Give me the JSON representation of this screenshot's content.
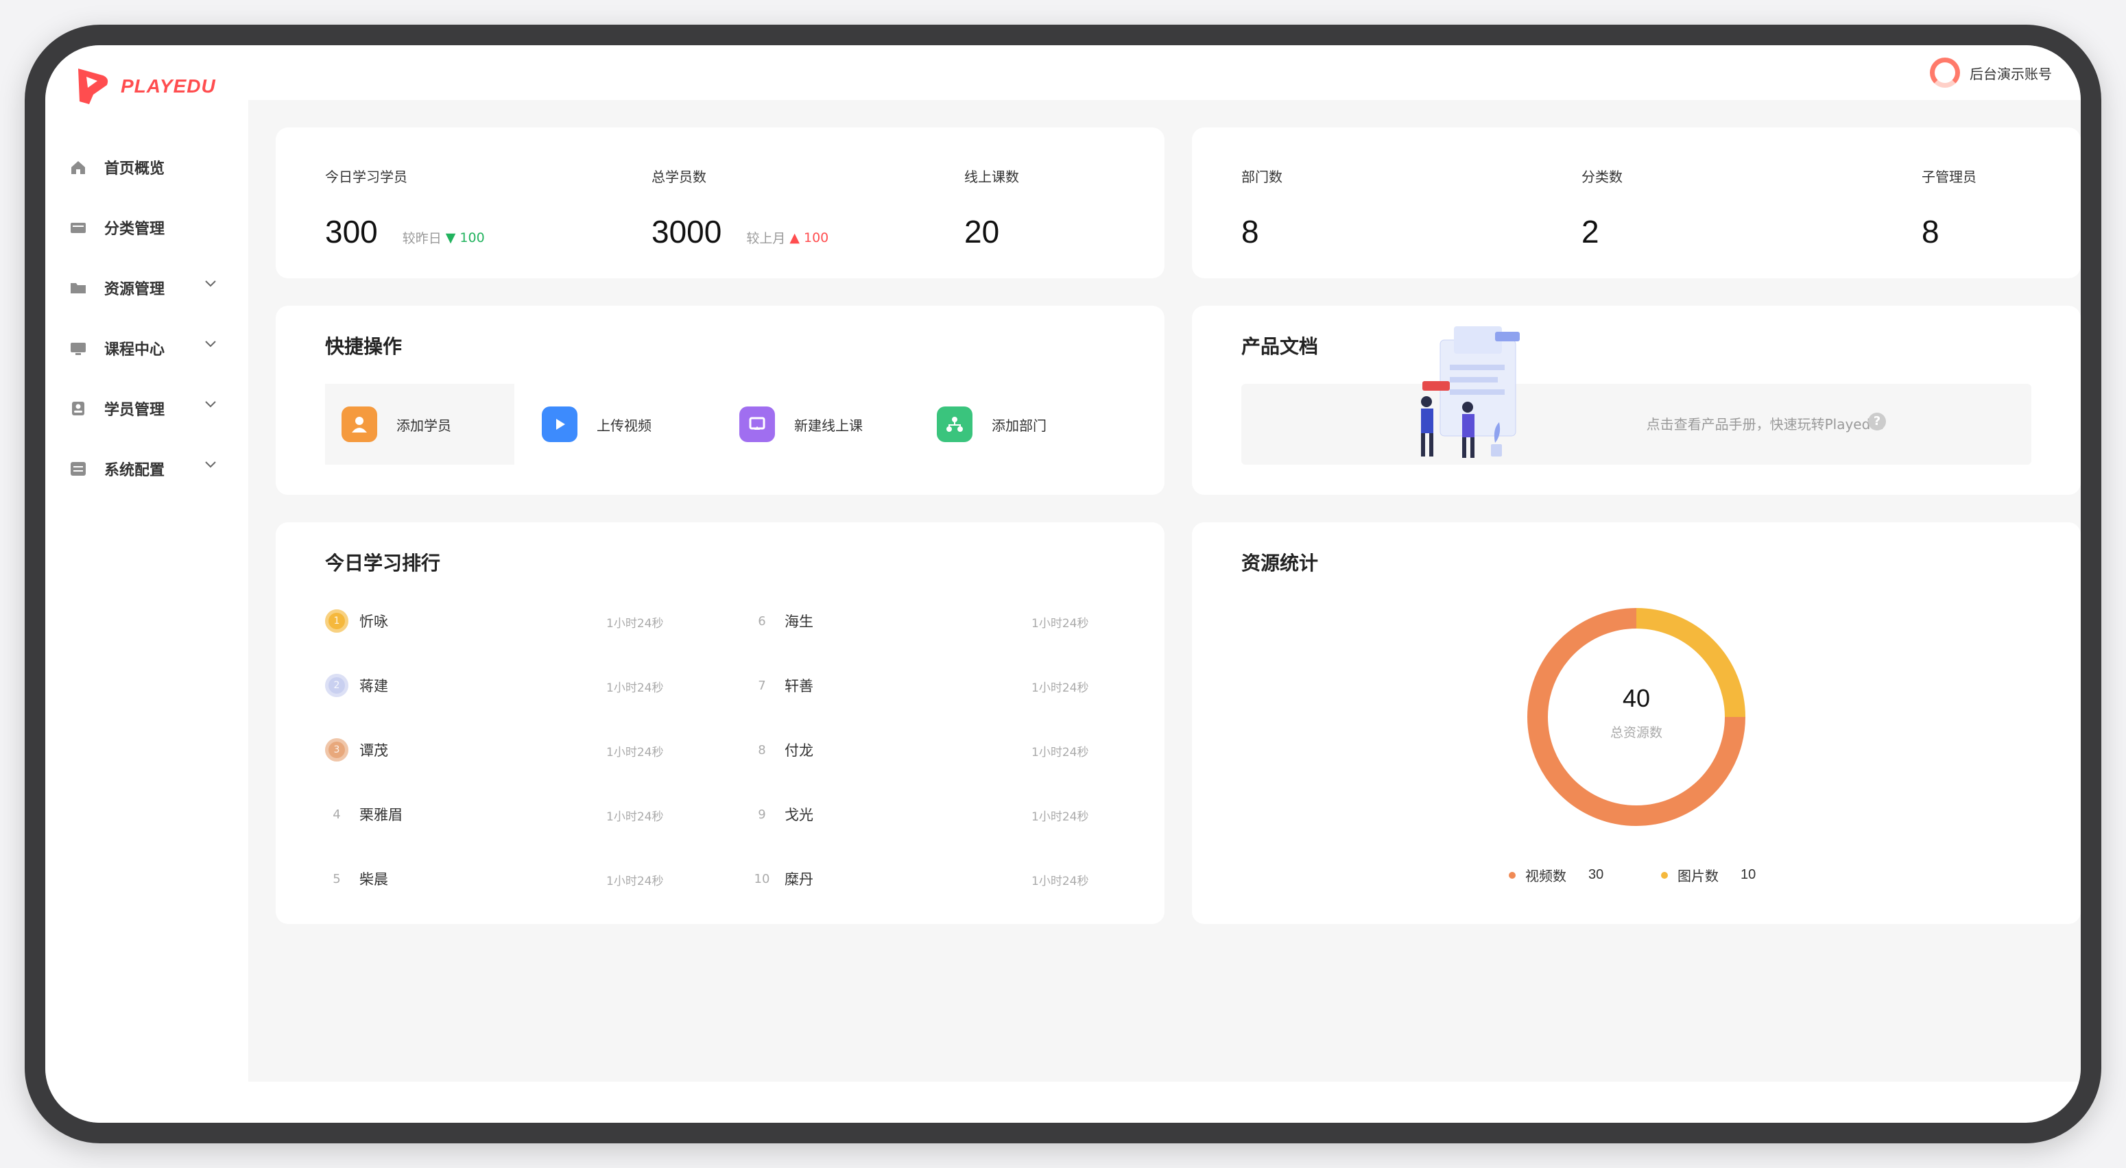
{
  "app": {
    "logo_text": "PLAYEDU",
    "brand_color": "#ff4d4f"
  },
  "topbar": {
    "user_name": "后台演示账号"
  },
  "sidebar": {
    "items": [
      {
        "label": "首页概览",
        "icon": "home-icon"
      },
      {
        "label": "分类管理",
        "icon": "category-icon"
      },
      {
        "label": "资源管理",
        "icon": "folder-icon"
      },
      {
        "label": "课程中心",
        "icon": "course-icon"
      },
      {
        "label": "学员管理",
        "icon": "user-icon"
      },
      {
        "label": "系统配置",
        "icon": "settings-icon"
      }
    ]
  },
  "stats_left": {
    "today_learners": {
      "label": "今日学习学员",
      "value": "300",
      "compare_label": "较昨日",
      "trend": "▼",
      "delta": "100"
    },
    "total_learners": {
      "label": "总学员数",
      "value": "3000",
      "compare_label": "较上月",
      "trend": "▲",
      "delta": "100"
    },
    "online_courses": {
      "label": "线上课数",
      "value": "20"
    }
  },
  "stats_right": {
    "departments": {
      "label": "部门数",
      "value": "8"
    },
    "categories": {
      "label": "分类数",
      "value": "2"
    },
    "sub_admins": {
      "label": "子管理员",
      "value": "8"
    }
  },
  "quick_actions": {
    "title": "快捷操作",
    "items": [
      {
        "label": "添加学员",
        "icon": "add-user-icon",
        "color": "#f59a3e"
      },
      {
        "label": "上传视频",
        "icon": "upload-video-icon",
        "color": "#3d8bfd"
      },
      {
        "label": "新建线上课",
        "icon": "new-course-icon",
        "color": "#a06ef0"
      },
      {
        "label": "添加部门",
        "icon": "add-department-icon",
        "color": "#3ac47d"
      }
    ]
  },
  "product_docs": {
    "title": "产品文档",
    "link_text": "点击查看产品手册，快速玩转Playedu!"
  },
  "ranking": {
    "title": "今日学习排行",
    "rows": [
      {
        "rank": "1",
        "name": "忻咏",
        "time": "1小时24秒"
      },
      {
        "rank": "2",
        "name": "蒋建",
        "time": "1小时24秒"
      },
      {
        "rank": "3",
        "name": "谭茂",
        "time": "1小时24秒"
      },
      {
        "rank": "4",
        "name": "栗雅眉",
        "time": "1小时24秒"
      },
      {
        "rank": "5",
        "name": "柴晨",
        "time": "1小时24秒"
      },
      {
        "rank": "6",
        "name": "海生",
        "time": "1小时24秒"
      },
      {
        "rank": "7",
        "name": "轩善",
        "time": "1小时24秒"
      },
      {
        "rank": "8",
        "name": "付龙",
        "time": "1小时24秒"
      },
      {
        "rank": "9",
        "name": "戈光",
        "time": "1小时24秒"
      },
      {
        "rank": "10",
        "name": "糜丹",
        "time": "1小时24秒"
      }
    ]
  },
  "resources": {
    "title": "资源统计",
    "total": "40",
    "total_label": "总资源数"
  },
  "chart_data": {
    "type": "pie",
    "categories": [
      "视频数",
      "图片数"
    ],
    "values": [
      30,
      10
    ],
    "colors": [
      "#f08a55",
      "#f5b83c"
    ]
  }
}
